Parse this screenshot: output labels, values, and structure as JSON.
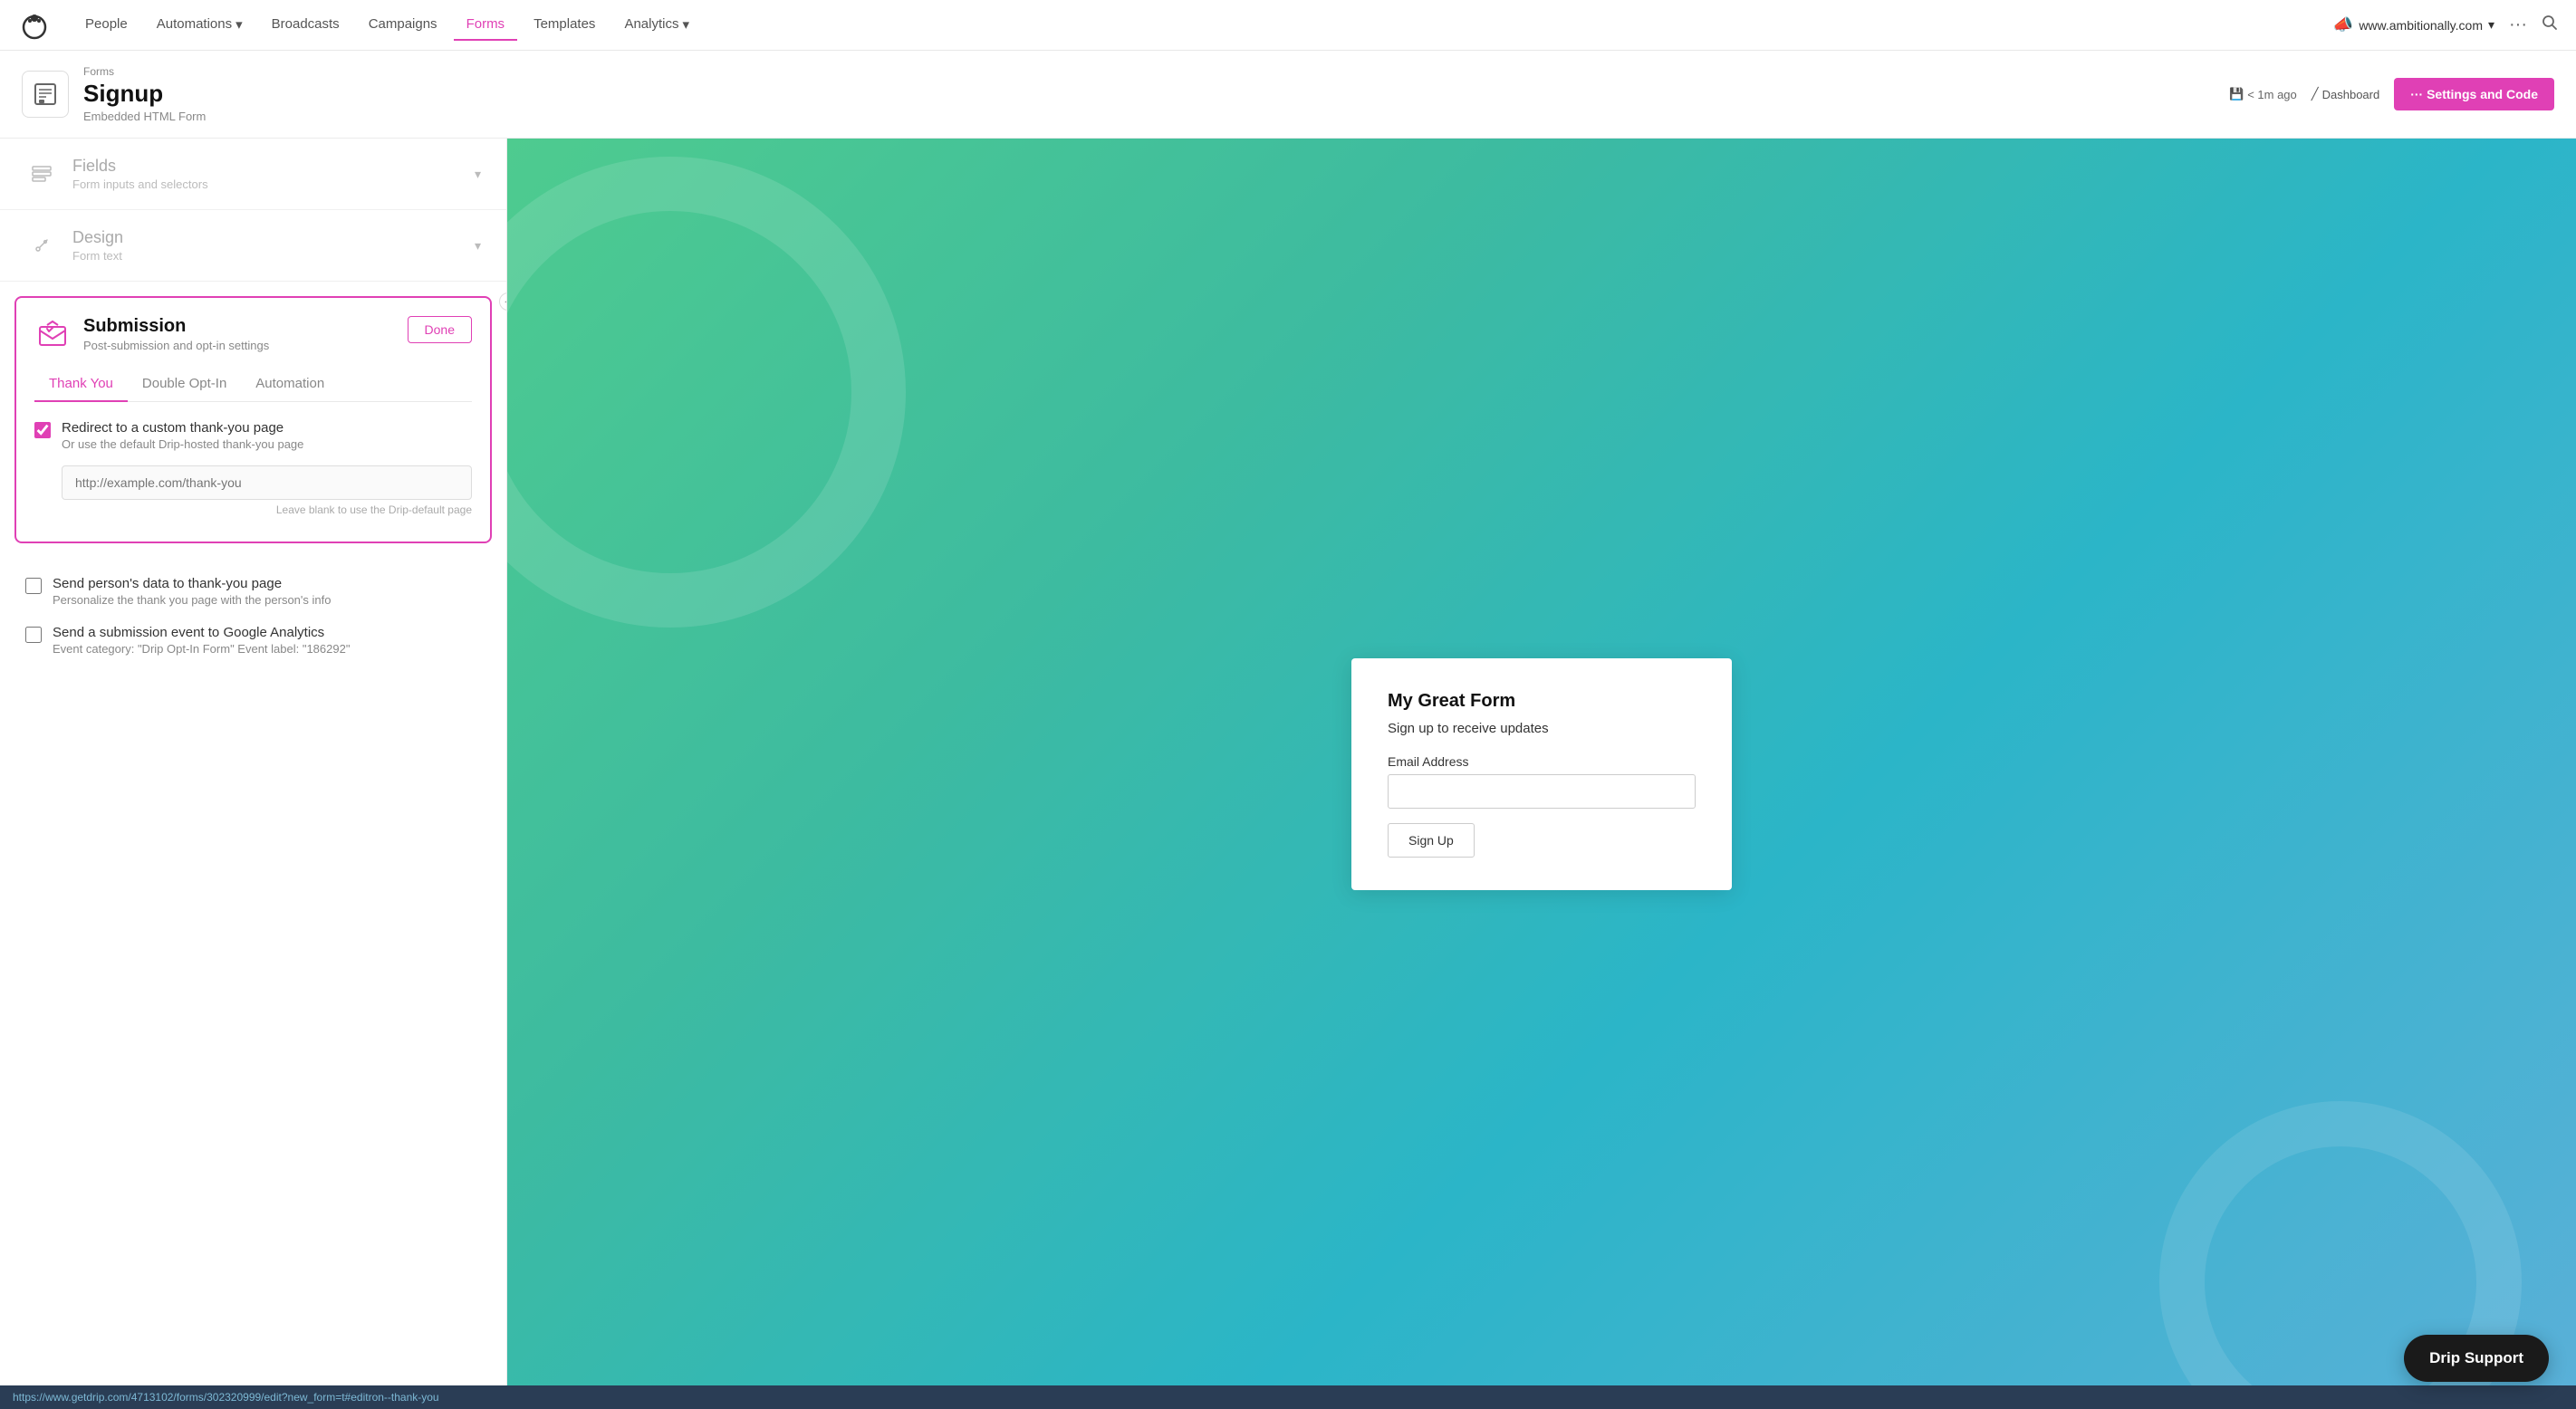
{
  "nav": {
    "logo_alt": "Drip logo",
    "links": [
      {
        "id": "people",
        "label": "People",
        "active": false,
        "dropdown": false
      },
      {
        "id": "automations",
        "label": "Automations",
        "active": false,
        "dropdown": true
      },
      {
        "id": "broadcasts",
        "label": "Broadcasts",
        "active": false,
        "dropdown": false
      },
      {
        "id": "campaigns",
        "label": "Campaigns",
        "active": false,
        "dropdown": false
      },
      {
        "id": "forms",
        "label": "Forms",
        "active": true,
        "dropdown": false
      },
      {
        "id": "templates",
        "label": "Templates",
        "active": false,
        "dropdown": false
      },
      {
        "id": "analytics",
        "label": "Analytics",
        "active": false,
        "dropdown": true
      }
    ],
    "site": "www.ambitionally.com",
    "more_label": "···"
  },
  "page_header": {
    "breadcrumb": "Forms",
    "title": "Signup",
    "subtitle": "Embedded HTML Form",
    "save_label": "< 1m ago",
    "dashboard_label": "Dashboard",
    "settings_label": "··· Settings and Code"
  },
  "left_panel": {
    "sections": [
      {
        "id": "fields",
        "title": "Fields",
        "subtitle": "Form inputs and selectors",
        "icon": "fields-icon"
      },
      {
        "id": "design",
        "title": "Design",
        "subtitle": "Form text",
        "icon": "design-icon"
      }
    ],
    "submission": {
      "title": "Submission",
      "subtitle": "Post-submission and opt-in settings",
      "done_label": "Done",
      "tabs": [
        {
          "id": "thank-you",
          "label": "Thank You",
          "active": true
        },
        {
          "id": "double-opt-in",
          "label": "Double Opt-In",
          "active": false
        },
        {
          "id": "automation",
          "label": "Automation",
          "active": false
        }
      ],
      "redirect": {
        "label": "Redirect to a custom thank-you page",
        "desc": "Or use the default Drip-hosted thank-you page",
        "checked": true,
        "placeholder": "http://example.com/thank-you",
        "hint": "Leave blank to use the Drip-default page"
      }
    },
    "below_options": [
      {
        "id": "send-data",
        "label": "Send person's data to thank-you page",
        "desc": "Personalize the thank you page with the person's info",
        "checked": false
      },
      {
        "id": "google-analytics",
        "label": "Send a submission event to Google Analytics",
        "desc": "Event category: \"Drip Opt-In Form\" Event label: \"186292\"",
        "checked": false
      }
    ]
  },
  "form_preview": {
    "title": "My Great Form",
    "desc": "Sign up to receive updates",
    "email_label": "Email Address",
    "email_placeholder": "",
    "submit_label": "Sign Up"
  },
  "drip_support": {
    "label": "Drip Support"
  },
  "url_bar": {
    "url": "https://www.getdrip.com/4713102/forms/302320999/edit?new_form=t#editron--thank-you"
  }
}
